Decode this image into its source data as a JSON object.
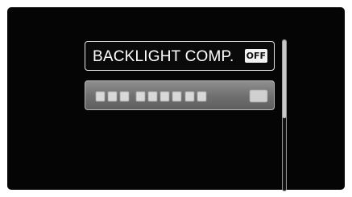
{
  "menu": {
    "items": [
      {
        "label": "BACKLIGHT COMP.",
        "value": "OFF",
        "state": "selected"
      },
      {
        "label": "",
        "value": "",
        "state": "obscured"
      }
    ]
  },
  "scrollbar": {
    "position": 0.0,
    "visible_fraction": 0.52
  },
  "colors": {
    "background": "#050505",
    "highlight_border": "#e8e8e8",
    "dimmed_item": "#7a7a7a"
  }
}
